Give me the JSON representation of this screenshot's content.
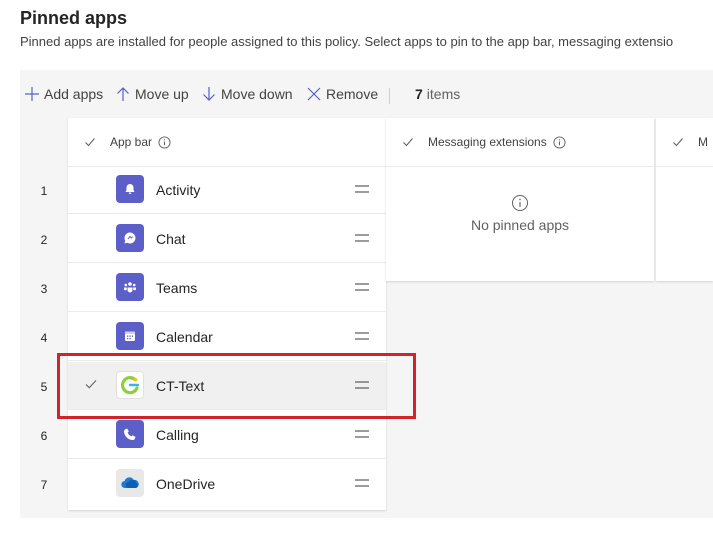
{
  "header": {
    "title": "Pinned apps",
    "subtitle": "Pinned apps are installed for people assigned to this policy. Select apps to pin to the app bar, messaging extensio"
  },
  "toolbar": {
    "add_label": "Add apps",
    "move_up_label": "Move up",
    "move_down_label": "Move down",
    "remove_label": "Remove",
    "count_number": "7",
    "count_label": "items"
  },
  "columns": {
    "app_bar": {
      "title": "App bar"
    },
    "messaging": {
      "title": "Messaging extensions",
      "empty_text": "No pinned apps"
    },
    "third": {
      "title": "M"
    }
  },
  "rows": [
    {
      "num": "1",
      "name": "Activity",
      "icon": "bell-icon",
      "color": "#5b5fc7"
    },
    {
      "num": "2",
      "name": "Chat",
      "icon": "chat-icon",
      "color": "#5b5fc7"
    },
    {
      "num": "3",
      "name": "Teams",
      "icon": "teams-icon",
      "color": "#5b5fc7"
    },
    {
      "num": "4",
      "name": "Calendar",
      "icon": "calendar-icon",
      "color": "#5b5fc7"
    },
    {
      "num": "5",
      "name": "CT-Text",
      "icon": "ct-text-logo-icon",
      "color": "#ffffff",
      "selected": true
    },
    {
      "num": "6",
      "name": "Calling",
      "icon": "phone-icon",
      "color": "#5b5fc7"
    },
    {
      "num": "7",
      "name": "OneDrive",
      "icon": "onedrive-icon",
      "color": "#e8e8e8"
    }
  ],
  "colors": {
    "accent": "#5b5fc7",
    "highlight": "#d1242a"
  }
}
